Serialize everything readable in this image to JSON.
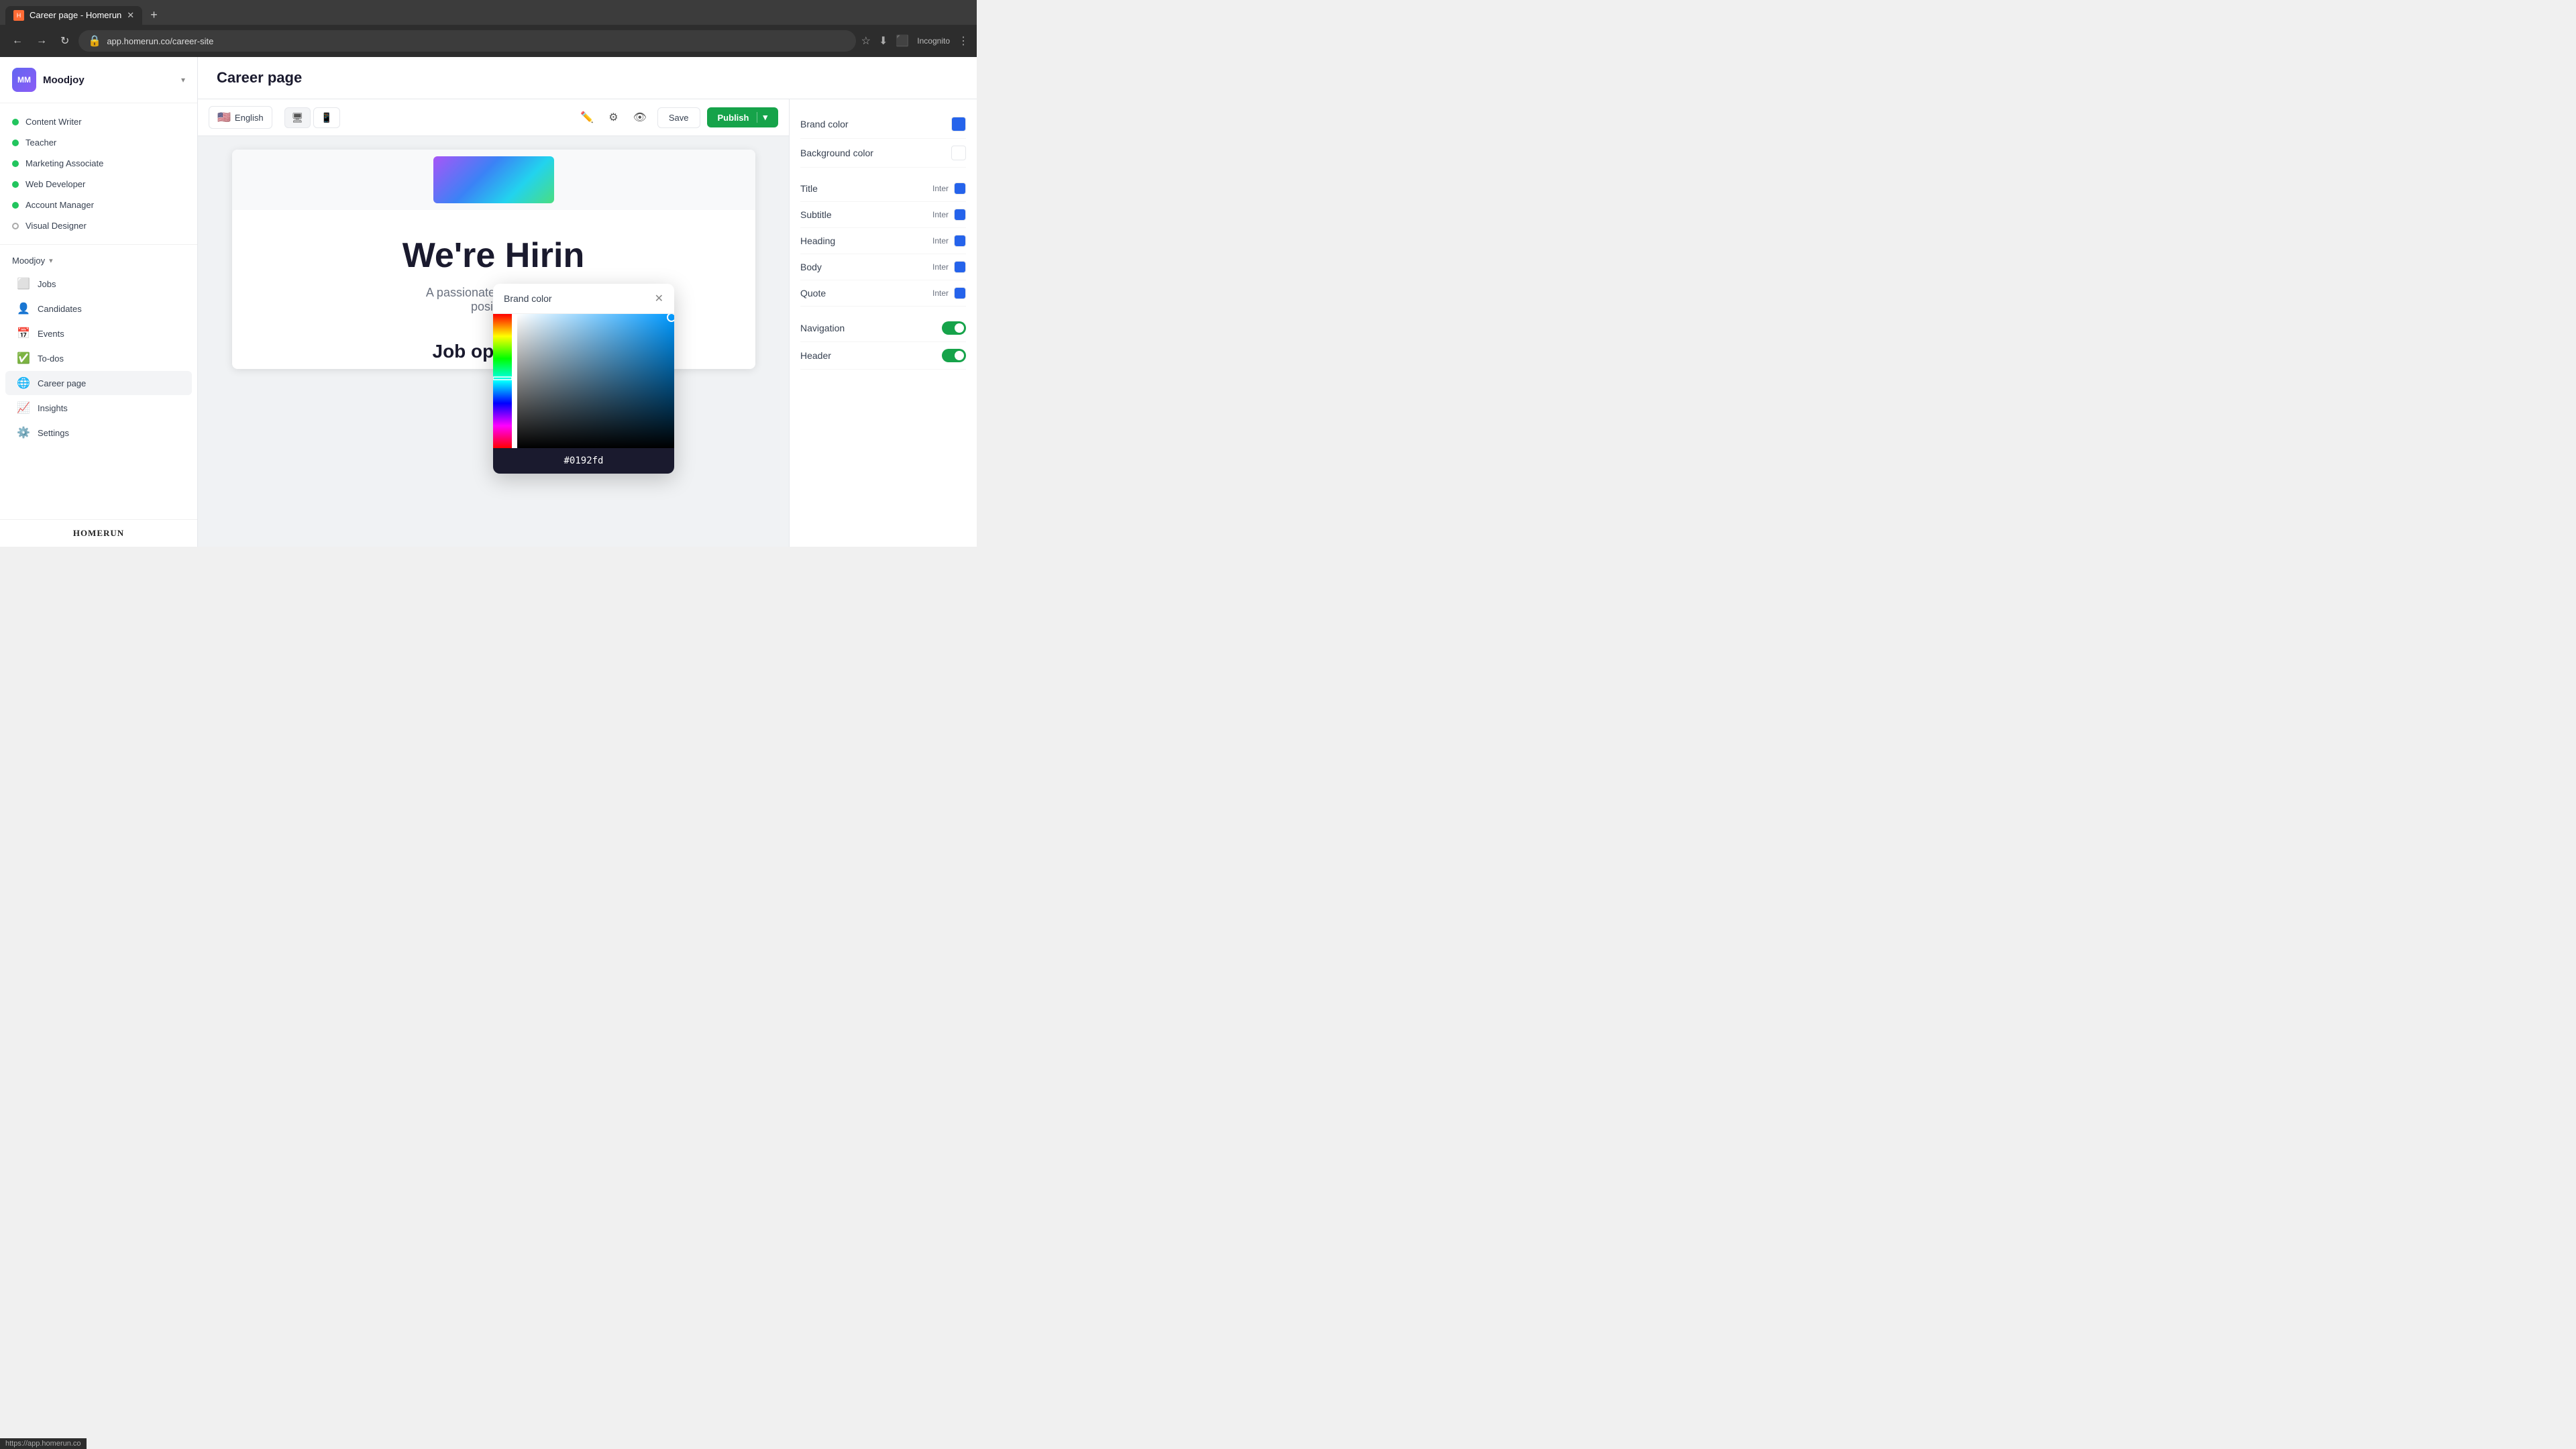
{
  "browser": {
    "tab_title": "Career page - Homerun",
    "tab_favicon": "H",
    "url": "app.homerun.co/career-site",
    "incognito_label": "Incognito"
  },
  "sidebar": {
    "brand": "Moodjoy",
    "avatar_initials": "MM",
    "job_items": [
      {
        "label": "Content Writer",
        "status": "green"
      },
      {
        "label": "Teacher",
        "status": "green"
      },
      {
        "label": "Marketing Associate",
        "status": "green"
      },
      {
        "label": "Web Developer",
        "status": "green"
      },
      {
        "label": "Account Manager",
        "status": "green"
      },
      {
        "label": "Visual Designer",
        "status": "outline"
      }
    ],
    "section_label": "Moodjoy",
    "nav_items": [
      {
        "icon": "💼",
        "label": "Jobs"
      },
      {
        "icon": "👥",
        "label": "Candidates"
      },
      {
        "icon": "📅",
        "label": "Events"
      },
      {
        "icon": "✅",
        "label": "To-dos"
      },
      {
        "icon": "🌐",
        "label": "Career page",
        "active": true
      },
      {
        "icon": "📊",
        "label": "Insights"
      },
      {
        "icon": "⚙️",
        "label": "Settings"
      }
    ],
    "footer_logo": "HOMERUN",
    "status_url": "https://app.homerun.co"
  },
  "header": {
    "page_title": "Career page"
  },
  "toolbar": {
    "lang_flag": "🇺🇸",
    "lang_label": "English",
    "save_label": "Save",
    "publish_label": "Publish"
  },
  "preview": {
    "hero_title": "We're Hirin",
    "hero_subtitle": "A passionate candidate... position!",
    "job_openings_label": "Job openings"
  },
  "color_picker": {
    "title": "Brand color",
    "hex_value": "#0192fd"
  },
  "right_panel": {
    "brand_color_label": "Brand color",
    "background_color_label": "Background color",
    "title_label": "Title",
    "title_font": "Inter",
    "subtitle_label": "Subtitle",
    "subtitle_font": "Inter",
    "heading_label": "Heading",
    "heading_font": "Inter",
    "body_label": "Body",
    "body_font": "Inter",
    "quote_label": "Quote",
    "quote_font": "Inter",
    "navigation_label": "Navigation",
    "header_label": "Header"
  }
}
